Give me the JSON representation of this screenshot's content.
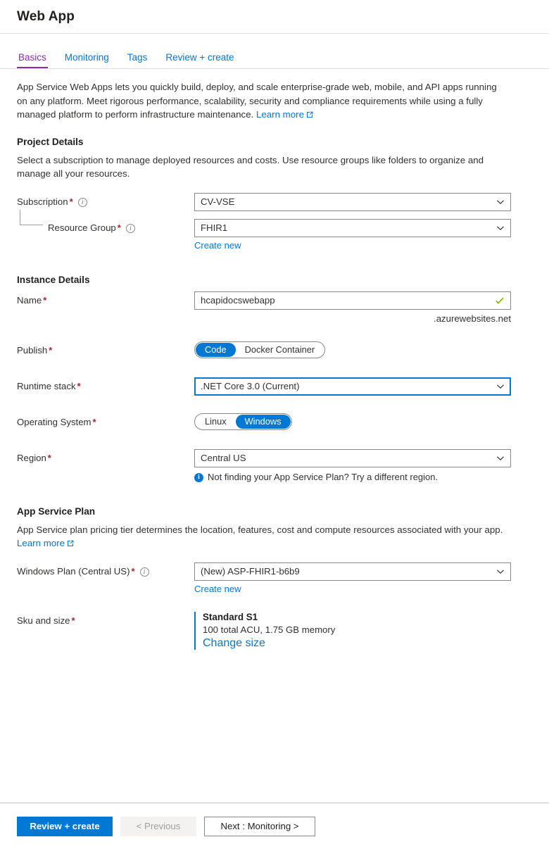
{
  "header": {
    "title": "Web App"
  },
  "tabs": [
    {
      "label": "Basics",
      "active": true
    },
    {
      "label": "Monitoring",
      "active": false
    },
    {
      "label": "Tags",
      "active": false
    },
    {
      "label": "Review + create",
      "active": false
    }
  ],
  "intro": {
    "text": "App Service Web Apps lets you quickly build, deploy, and scale enterprise-grade web, mobile, and API apps running on any platform. Meet rigorous performance, scalability, security and compliance requirements while using a fully managed platform to perform infrastructure maintenance. ",
    "learn_more": "Learn more"
  },
  "project_details": {
    "title": "Project Details",
    "description": "Select a subscription to manage deployed resources and costs. Use resource groups like folders to organize and manage all your resources.",
    "subscription": {
      "label": "Subscription",
      "value": "CV-VSE",
      "required": true,
      "has_info": true
    },
    "resource_group": {
      "label": "Resource Group",
      "value": "FHIR1",
      "required": true,
      "has_info": true,
      "create_new": "Create new"
    }
  },
  "instance_details": {
    "title": "Instance Details",
    "name": {
      "label": "Name",
      "value": "hcapidocswebapp",
      "required": true,
      "valid": true,
      "suffix": ".azurewebsites.net"
    },
    "publish": {
      "label": "Publish",
      "required": true,
      "options": [
        "Code",
        "Docker Container"
      ],
      "selected": "Code"
    },
    "runtime_stack": {
      "label": "Runtime stack",
      "value": ".NET Core 3.0 (Current)",
      "required": true,
      "focused": true
    },
    "operating_system": {
      "label": "Operating System",
      "required": true,
      "options": [
        "Linux",
        "Windows"
      ],
      "selected": "Windows"
    },
    "region": {
      "label": "Region",
      "value": "Central US",
      "required": true,
      "info_message": "Not finding your App Service Plan? Try a different region."
    }
  },
  "app_service_plan": {
    "title": "App Service Plan",
    "description": "App Service plan pricing tier determines the location, features, cost and compute resources associated with your app.",
    "learn_more": "Learn more",
    "windows_plan": {
      "label": "Windows Plan (Central US)",
      "value": "(New) ASP-FHIR1-b6b9",
      "required": true,
      "has_info": true,
      "create_new": "Create new"
    },
    "sku_and_size": {
      "label": "Sku and size",
      "required": true,
      "name": "Standard S1",
      "description": "100 total ACU, 1.75 GB memory",
      "change_link": "Change size"
    }
  },
  "footer": {
    "review_create": "Review + create",
    "previous": "< Previous",
    "next": "Next : Monitoring >"
  },
  "colors": {
    "accent": "#0078d4",
    "active_tab": "#8c2da8",
    "required": "#a4262c",
    "valid_check": "#7fba00",
    "border": "#8a8886"
  },
  "icons": {
    "chevron_down": "chevron-down-icon",
    "external_link": "external-link-icon",
    "info": "info-icon",
    "check": "check-icon"
  }
}
